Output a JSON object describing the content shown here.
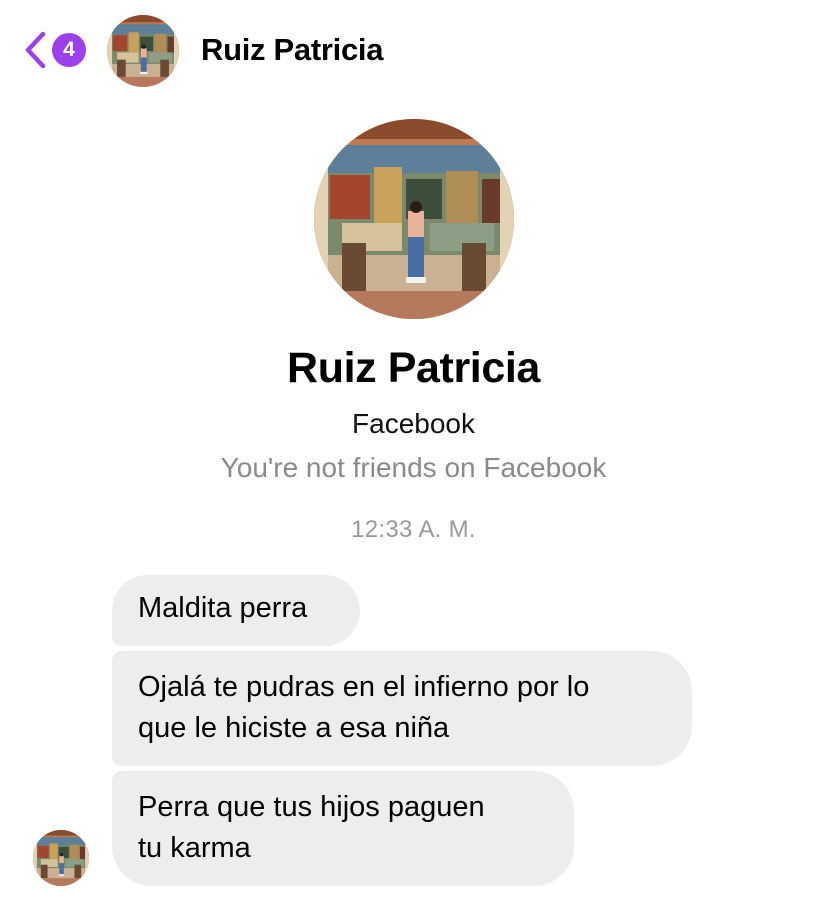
{
  "header": {
    "back_badge_count": "4",
    "contact_name": "Ruiz Patricia"
  },
  "profile": {
    "name": "Ruiz Patricia",
    "network": "Facebook",
    "relationship": "You're not friends on Facebook"
  },
  "conversation": {
    "timestamp": "12:33 A. M.",
    "messages": [
      {
        "lines": [
          "Maldita perra"
        ]
      },
      {
        "lines": [
          "Ojalá te pudras en el infierno por lo",
          "que le hiciste a esa niña"
        ]
      },
      {
        "lines": [
          "Perra que tus hijos paguen",
          "tu karma"
        ]
      }
    ]
  },
  "colors": {
    "accent": "#9b40ea",
    "bubble_background": "#ededf0",
    "secondary_text": "#8a8a8e"
  }
}
